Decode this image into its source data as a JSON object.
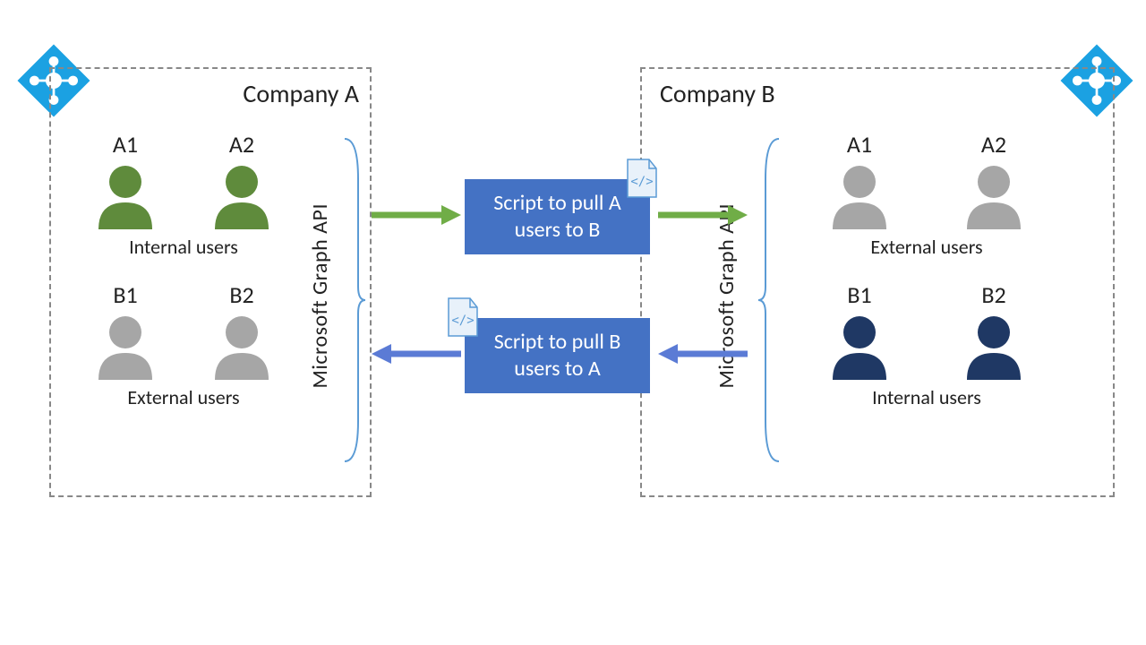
{
  "companyA": {
    "title": "Company A",
    "internal_label": "Internal users",
    "external_label": "External users",
    "users_internal": [
      "A1",
      "A2"
    ],
    "users_external": [
      "B1",
      "B2"
    ],
    "api_label": "Microsoft Graph API"
  },
  "companyB": {
    "title": "Company B",
    "external_label": "External users",
    "internal_label": "Internal users",
    "users_external": [
      "A1",
      "A2"
    ],
    "users_internal": [
      "B1",
      "B2"
    ],
    "api_label": "Microsoft Graph API"
  },
  "scripts": {
    "a_to_b": "Script to pull A users to B",
    "b_to_a": "Script to pull B users to A",
    "doc_glyph": "</>"
  },
  "colors": {
    "green": "#5F8B3C",
    "gray": "#A6A6A6",
    "navy": "#1F3864",
    "box_blue": "#4472C4",
    "azure": "#1BA1E2",
    "arrow_green": "#70AD47",
    "arrow_blue": "#5B7BD5"
  }
}
